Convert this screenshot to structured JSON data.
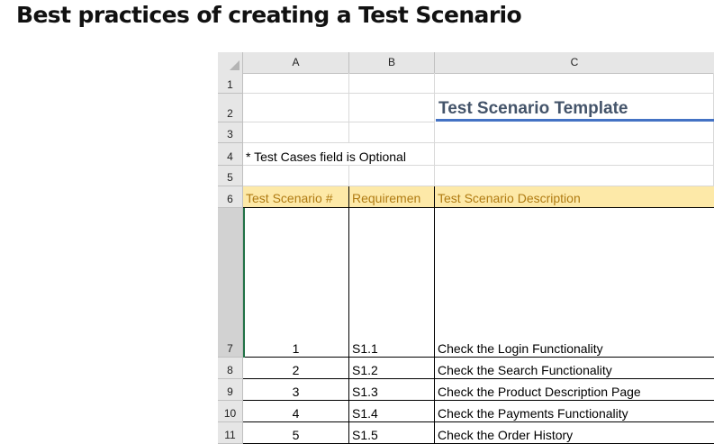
{
  "page": {
    "heading": "Best practices of creating a Test Scenario"
  },
  "spreadsheet": {
    "columns": [
      "A",
      "B",
      "C"
    ],
    "rows": [
      "1",
      "2",
      "3",
      "4",
      "5",
      "6",
      "7",
      "8",
      "9",
      "10",
      "11"
    ],
    "title": "Test Scenario Template",
    "note": "* Test Cases field is Optional",
    "table_headers": [
      "Test Scenario #",
      "Requiremen",
      "Test Scenario Description"
    ],
    "table_rows": [
      {
        "num": "1",
        "req": "S1.1",
        "desc": "Check the Login Functionality"
      },
      {
        "num": "2",
        "req": "S1.2",
        "desc": "Check the Search Functionality"
      },
      {
        "num": "3",
        "req": "S1.3",
        "desc": "Check the Product Description Page"
      },
      {
        "num": "4",
        "req": "S1.4",
        "desc": "Check the Payments Functionality"
      },
      {
        "num": "5",
        "req": "S1.5",
        "desc": "Check the Order History"
      }
    ]
  },
  "colors": {
    "header_fill": "#fde9a8",
    "header_text": "#b07b12",
    "title_text": "#44546a",
    "title_underline": "#4472c4",
    "active_cell_border": "#217346"
  }
}
